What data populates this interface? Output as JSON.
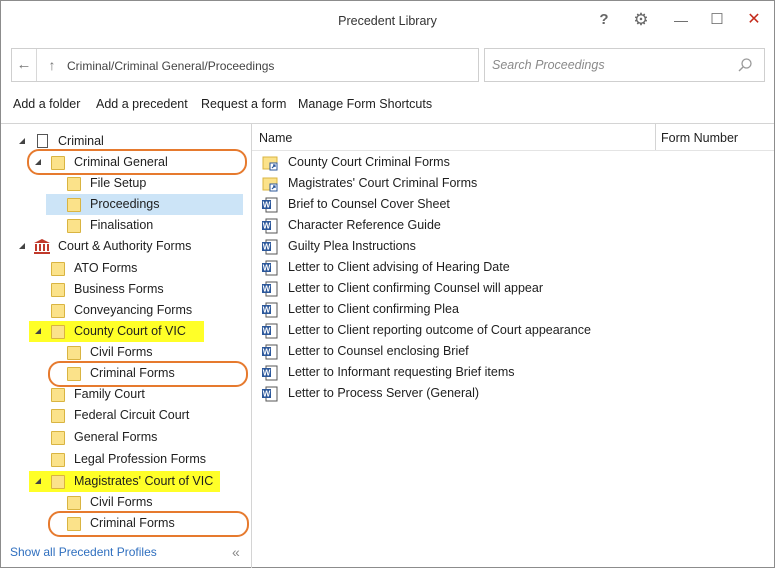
{
  "window": {
    "title": "Precedent Library",
    "help_label": "?"
  },
  "address": {
    "path": "Criminal/Criminal General/Proceedings"
  },
  "search": {
    "placeholder": "Search Proceedings",
    "value": ""
  },
  "toolbar": {
    "add_folder": "Add a folder",
    "add_precedent": "Add a precedent",
    "request_form": "Request a form",
    "manage_shortcuts": "Manage Form Shortcuts"
  },
  "tree": {
    "items": [
      {
        "label": "Criminal",
        "icon": "document-icon"
      },
      {
        "label": "Criminal General",
        "icon": "folder-icon"
      },
      {
        "label": "File Setup",
        "icon": "folder-icon"
      },
      {
        "label": "Proceedings",
        "icon": "folder-icon",
        "selected": true
      },
      {
        "label": "Finalisation",
        "icon": "folder-icon"
      },
      {
        "label": "Court & Authority Forms",
        "icon": "court-icon"
      },
      {
        "label": "ATO Forms",
        "icon": "folder-icon"
      },
      {
        "label": "Business Forms",
        "icon": "folder-icon"
      },
      {
        "label": "Conveyancing Forms",
        "icon": "folder-icon"
      },
      {
        "label": "County Court of VIC",
        "icon": "folder-icon"
      },
      {
        "label": "Civil Forms",
        "icon": "folder-icon"
      },
      {
        "label": "Criminal Forms",
        "icon": "folder-icon"
      },
      {
        "label": "Family Court",
        "icon": "folder-icon"
      },
      {
        "label": "Federal Circuit Court",
        "icon": "folder-icon"
      },
      {
        "label": "General Forms",
        "icon": "folder-icon"
      },
      {
        "label": "Legal Profession Forms",
        "icon": "folder-icon"
      },
      {
        "label": "Magistrates' Court of VIC",
        "icon": "folder-icon"
      },
      {
        "label": "Civil Forms",
        "icon": "folder-icon"
      },
      {
        "label": "Criminal Forms",
        "icon": "folder-icon"
      }
    ],
    "show_all_label": "Show all Precedent Profiles"
  },
  "list": {
    "columns": [
      "Name",
      "Form Number"
    ],
    "rows": [
      {
        "name": "County Court Criminal Forms",
        "icon": "folder-shortcut-icon"
      },
      {
        "name": "Magistrates' Court Criminal Forms",
        "icon": "folder-shortcut-icon"
      },
      {
        "name": "Brief to Counsel Cover Sheet",
        "icon": "word-document-icon"
      },
      {
        "name": "Character Reference Guide",
        "icon": "word-document-icon"
      },
      {
        "name": "Guilty Plea Instructions",
        "icon": "word-document-icon"
      },
      {
        "name": "Letter to Client advising of Hearing Date",
        "icon": "word-document-icon"
      },
      {
        "name": "Letter to Client confirming Counsel will appear",
        "icon": "word-document-icon"
      },
      {
        "name": "Letter to Client confirming Plea",
        "icon": "word-document-icon"
      },
      {
        "name": "Letter to Client reporting outcome of Court appearance",
        "icon": "word-document-icon"
      },
      {
        "name": "Letter to Counsel enclosing Brief",
        "icon": "word-document-icon"
      },
      {
        "name": "Letter to Informant requesting Brief items",
        "icon": "word-document-icon"
      },
      {
        "name": "Letter to Process Server (General)",
        "icon": "word-document-icon"
      }
    ]
  },
  "colors": {
    "selection": "#cce4f7",
    "highlight": "#ffff28",
    "annotation_ring": "#e67a2e",
    "folder": "#fbe28a",
    "link": "#2f6fbf",
    "word_blue": "#2b579a"
  }
}
